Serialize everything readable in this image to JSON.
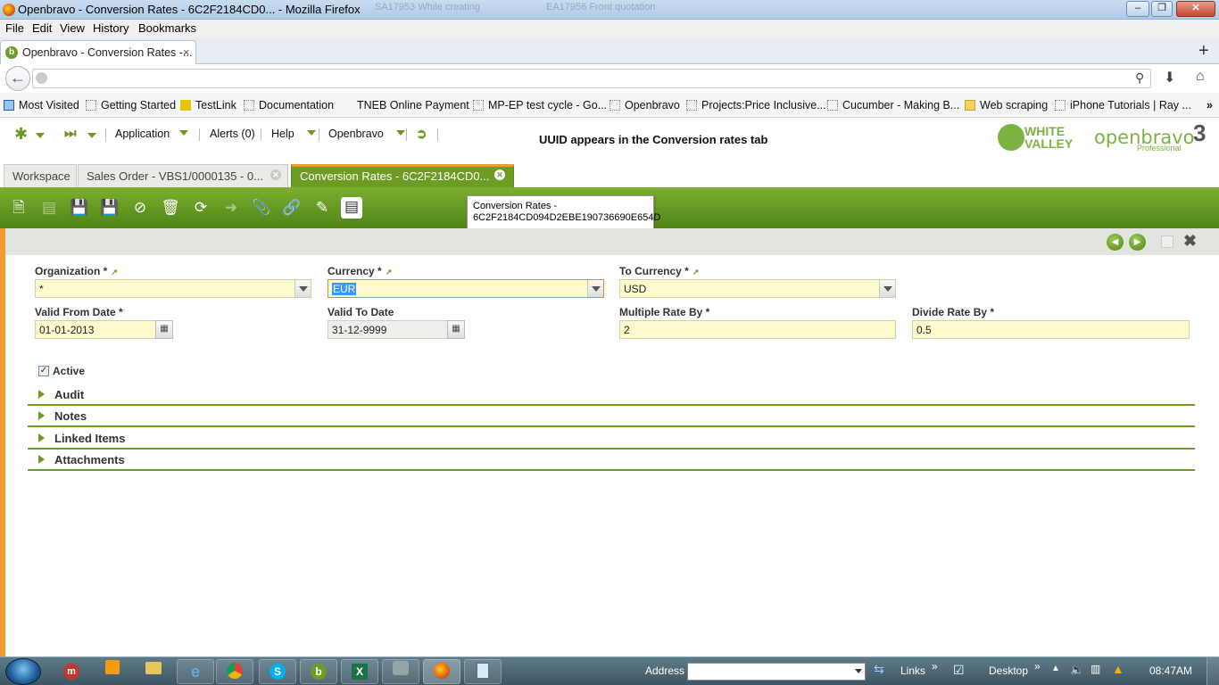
{
  "window": {
    "title": "Openbravo - Conversion Rates - 6C2F2184CD0... - Mozilla Firefox",
    "ghost_tabs": [
      "SA17953 While creating",
      "EA17956 Front quotation"
    ]
  },
  "menubar": [
    "File",
    "Edit",
    "View",
    "History",
    "Bookmarks"
  ],
  "browser_tab": {
    "label": "Openbravo - Conversion Rates -..."
  },
  "bookmarks": [
    "Most Visited",
    "Getting Started",
    "TestLink",
    "Documentation",
    "TNEB Online Payment",
    "MP-EP test cycle - Go...",
    "Openbravo",
    "Projects:Price Inclusive...",
    "Cucumber - Making B...",
    "Web scraping",
    "iPhone Tutorials | Ray ..."
  ],
  "app_header": {
    "menus": {
      "application": "Application",
      "alerts": "Alerts (0)",
      "help": "Help",
      "openbravo": "Openbravo"
    },
    "notice": "UUID appears in the Conversion rates tab",
    "logo_white_valley": "WHITE VALLEY",
    "logo_openbravo": "openbravo",
    "logo_version": "3",
    "logo_edition": "Professional"
  },
  "app_tabs": [
    "Workspace",
    "Sales Order - VBS1/0000135 - 0...",
    "Conversion Rates - 6C2F2184CD0..."
  ],
  "tooltip": {
    "line1": "Conversion Rates -",
    "line2": "6C2F2184CD094D2EBE190736690E654D"
  },
  "form": {
    "organization": {
      "label": "Organization *",
      "value": "*"
    },
    "currency": {
      "label": "Currency *",
      "value": "EUR"
    },
    "to_currency": {
      "label": "To Currency *",
      "value": "USD"
    },
    "valid_from": {
      "label": "Valid From Date *",
      "value": "01-01-2013"
    },
    "valid_to": {
      "label": "Valid To Date",
      "value": "31-12-9999"
    },
    "multiple_rate": {
      "label": "Multiple Rate By *",
      "value": "2"
    },
    "divide_rate": {
      "label": "Divide Rate By *",
      "value": "0.5"
    },
    "active": {
      "label": "Active",
      "checked": true
    }
  },
  "sections": [
    "Audit",
    "Notes",
    "Linked Items",
    "Attachments"
  ],
  "taskbar": {
    "address_label": "Address",
    "links_label": "Links",
    "desktop_label": "Desktop",
    "clock": "08:47AM"
  }
}
